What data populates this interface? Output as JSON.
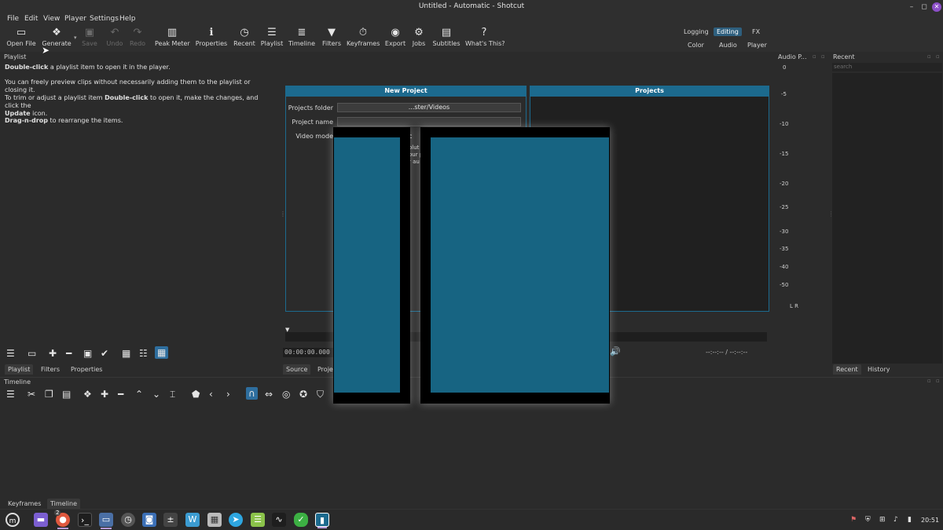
{
  "window": {
    "title": "Untitled - Automatic - Shotcut"
  },
  "menu": [
    "File",
    "Edit",
    "View",
    "Player",
    "Settings",
    "Help"
  ],
  "toolbar": {
    "open_file": "Open File",
    "generate": "Generate",
    "save": "Save",
    "undo": "Undo",
    "redo": "Redo",
    "peak_meter": "Peak Meter",
    "properties": "Properties",
    "recent": "Recent",
    "playlist": "Playlist",
    "timeline": "Timeline",
    "filters": "Filters",
    "keyframes": "Keyframes",
    "export": "Export",
    "jobs": "Jobs",
    "subtitles": "Subtitles",
    "whats_this": "What's This?"
  },
  "layouts": {
    "logging": "Logging",
    "editing": "Editing",
    "fx": "FX",
    "color": "Color",
    "audio": "Audio",
    "player": "Player"
  },
  "playlist_panel": {
    "title": "Playlist",
    "hint1_bold": "Double-click",
    "hint1_rest": " a playlist item to open it in the player.",
    "hint2": "You can freely preview clips without necessarily adding them to the playlist or closing it.",
    "hint3_pre": "To trim or adjust a playlist item ",
    "hint3_bold": "Double-click",
    "hint3_rest": " to open it, make the changes, and click the",
    "hint3_bold2": "Update",
    "hint3_end": " icon.",
    "hint4_bold": "Drag-n-drop",
    "hint4_rest": " to rearrange the items.",
    "tabs": [
      "Playlist",
      "Filters",
      "Properties"
    ]
  },
  "new_project": {
    "title": "New Project",
    "projects_title": "Projects",
    "projects_folder_label": "Projects folder",
    "projects_folder_value": "...ster/Videos",
    "project_name_label": "Project name",
    "video_mode_label": "Video mode",
    "video_mode_partial": "c",
    "desc_partial": [
      "olut",
      "our p",
      "r au"
    ]
  },
  "player": {
    "timecode": "00:00:00.000",
    "duration": "--:--:-- / --:--:--",
    "tabs": [
      "Source",
      "Proje"
    ]
  },
  "audio_meter": {
    "title": "Audio P...",
    "ticks": [
      "0",
      "-5",
      "-10",
      "-15",
      "-20",
      "-25",
      "-30",
      "-35",
      "-40",
      "-50"
    ],
    "channels": "L  R"
  },
  "recent_panel": {
    "title": "Recent",
    "search_placeholder": "search",
    "tabs": [
      "Recent",
      "History"
    ]
  },
  "timeline_panel": {
    "title": "Timeline",
    "bottom_tabs": [
      "Keyframes",
      "Timeline"
    ]
  },
  "taskbar": {
    "badge": "2",
    "clock": "20:51"
  },
  "colors": {
    "accent": "#1c6a8e",
    "overlay_fill": "#176482",
    "active_layout": "#2e5f7e",
    "close_button": "#8c4fc9"
  }
}
